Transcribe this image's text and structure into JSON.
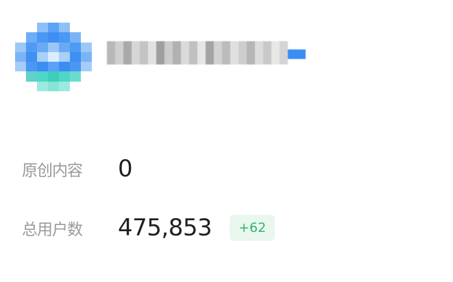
{
  "stats": {
    "original_content": {
      "label": "原创内容",
      "value": "0"
    },
    "total_users": {
      "label": "总用户数",
      "value": "475,853",
      "delta": "+62"
    }
  },
  "colors": {
    "accent_blue": "#3b8df3",
    "delta_green": "#34b36a",
    "delta_bg": "#e9f7ee",
    "label_gray": "#9a9a9a"
  }
}
